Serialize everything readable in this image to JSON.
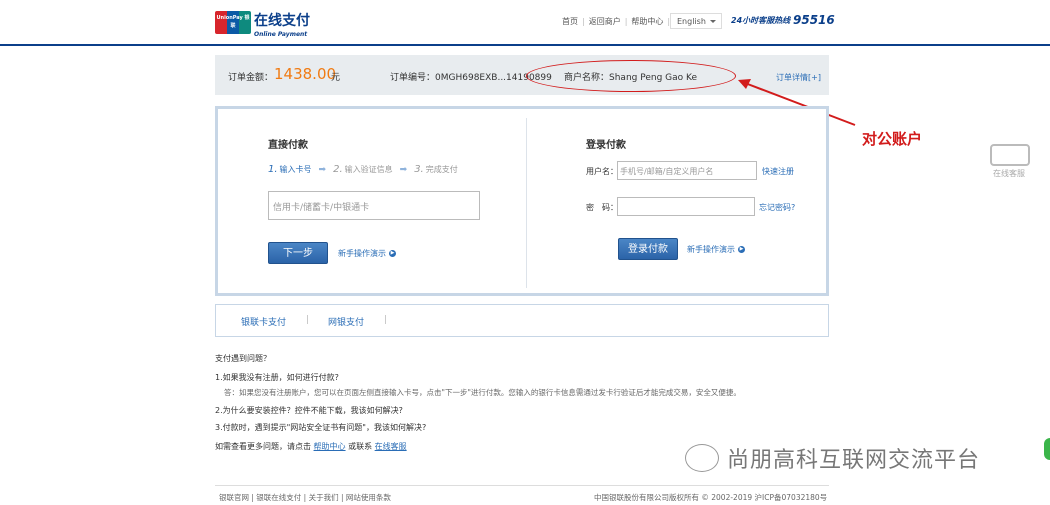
{
  "header": {
    "logo_text": "UnionPay 银联",
    "brand_zh": "在线支付",
    "brand_en": "Online Payment",
    "nav": [
      "首页",
      "返回商户",
      "帮助中心"
    ],
    "language": "English",
    "hotline_label": "24小时客服热线",
    "hotline_number": "95516"
  },
  "order": {
    "amount_label": "订单金额：",
    "amount": "1438.00",
    "currency": "元",
    "order_no_label": "订单编号：",
    "order_no": "0MGH698EXB...14190899",
    "merchant_label": "商户名称：",
    "merchant": "Shang Peng Gao Ke",
    "detail_link": "订单详情[+]"
  },
  "annotation": "对公账户",
  "direct_pay": {
    "title": "直接付款",
    "steps": [
      {
        "num": "1.",
        "label": "输入卡号"
      },
      {
        "num": "2.",
        "label": "输入验证信息"
      },
      {
        "num": "3.",
        "label": "完成支付"
      }
    ],
    "card_placeholder": "信用卡/储蓄卡/中银通卡",
    "next_button": "下一步",
    "guide": "新手操作演示"
  },
  "login_pay": {
    "title": "登录付款",
    "username_label": "用户名：",
    "username_placeholder": "手机号/邮箱/自定义用户名",
    "quick_register": "快速注册",
    "password_label": "密　码：",
    "forgot_password": "忘记密码?",
    "login_button": "登录付款",
    "guide": "新手操作演示"
  },
  "tabs": [
    "银联卡支付",
    "网银支付"
  ],
  "faq": {
    "title": "支付遇到问题？",
    "q1": "1.如果我没有注册，如何进行付款?",
    "a1": "答：如果您没有注册账户，您可以在页面左侧直接输入卡号，点击\"下一步\"进行付款。您输入的银行卡信息需通过发卡行验证后才能完成交易，安全又便捷。",
    "q2": "2.为什么要安装控件？控件不能下载，我该如何解决?",
    "q3": "3.付款时，遇到提示\"网站安全证书有问题\"，我该如何解决?",
    "more_prefix": "如需查看更多问题，请点击",
    "help_link": "帮助中心",
    "or": "或联系",
    "service_link": "在线客服"
  },
  "service_widget": "在线客服",
  "watermark": "尚朋高科互联网交流平台",
  "footer": {
    "links": [
      "银联官网",
      "银联在线支付",
      "关于我们",
      "网站使用条款"
    ],
    "copyright": "中国银联股份有限公司版权所有 © 2002-2019  沪ICP备07032180号"
  }
}
